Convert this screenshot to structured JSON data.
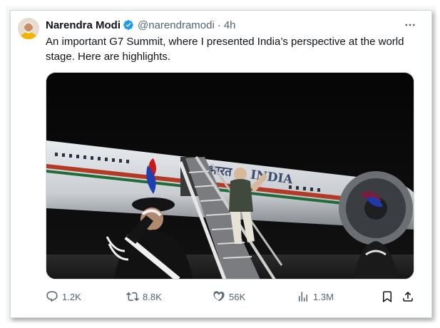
{
  "tweet": {
    "author_name": "Narendra Modi",
    "handle": "@narendramodi",
    "separator": "·",
    "time": "4h",
    "text": "An important G7 Summit, where I presented India’s perspective at the world stage. Here are highlights.",
    "media": {
      "fuselage_text": "भारत ◎ INDIA"
    }
  },
  "actions": {
    "replies": "1.2K",
    "retweets": "8.8K",
    "likes": "56K",
    "views": "1.3M"
  },
  "icons": {
    "verified": "verified-badge-icon",
    "more": "more-options-icon",
    "reply": "reply-icon",
    "retweet": "retweet-icon",
    "like": "heart-icon",
    "views": "views-chart-icon",
    "bookmark": "bookmark-icon",
    "share": "share-icon"
  },
  "colors": {
    "verified_blue": "#1d9bf0",
    "secondary_text": "#536471",
    "primary_text": "#0f1419"
  }
}
